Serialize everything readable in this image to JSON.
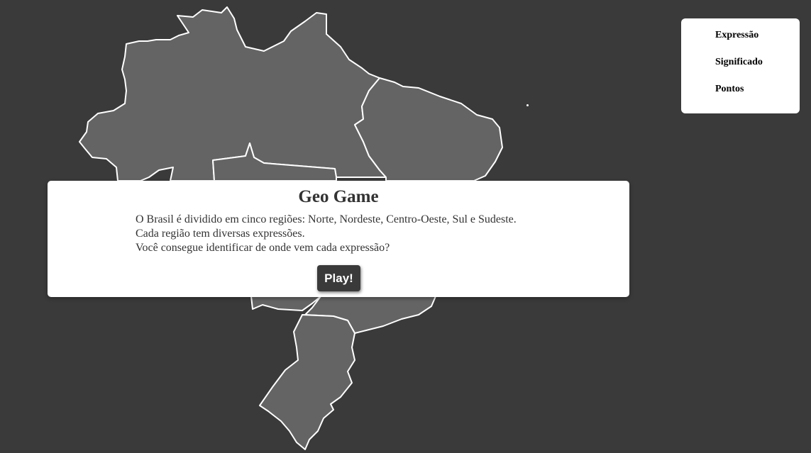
{
  "game": {
    "title": "Geo Game"
  },
  "score_panel": {
    "expression_label": "Expressão",
    "meaning_label": "Significado",
    "points_label": "Pontos"
  },
  "modal": {
    "title": "Geo Game",
    "lines": [
      "O Brasil é dividido em cinco regiões: Norte, Nordeste, Centro-Oeste, Sul e Sudeste.",
      "Cada região tem diversas expressões.",
      "Você consegue identificar de onde vem cada expressão?"
    ],
    "play_label": "Play!"
  },
  "colors": {
    "background": "#3a3a3a",
    "region_fill": "#646464",
    "region_border": "#ffffff",
    "button_bg": "#3a3a3a"
  }
}
